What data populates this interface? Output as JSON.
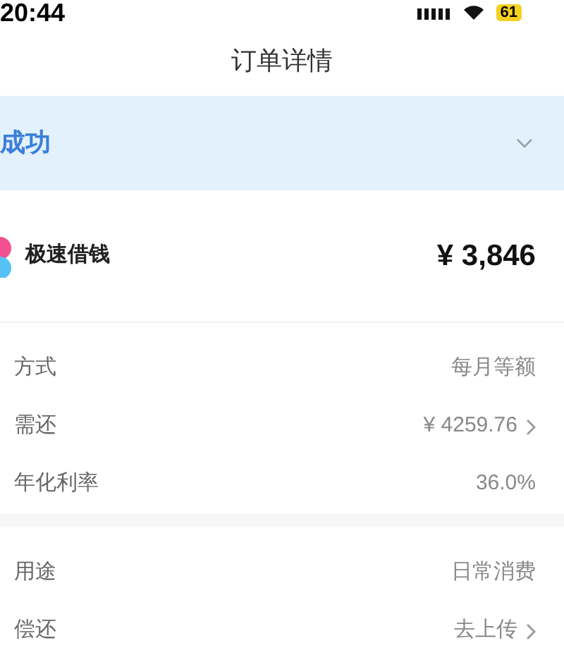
{
  "status_bar": {
    "time": "20:44",
    "battery": "61"
  },
  "header": {
    "title": "订单详情"
  },
  "status_banner": {
    "text": "成功",
    "expanded": false
  },
  "product": {
    "name": "极速借钱",
    "amount": "¥ 3,846"
  },
  "sections": [
    {
      "rows": [
        {
          "label": "方式",
          "value": "每月等额",
          "link": false
        },
        {
          "label": "需还",
          "value": "¥ 4259.76",
          "link": true
        },
        {
          "label": "年化利率",
          "value": "36.0%",
          "link": false
        }
      ]
    },
    {
      "rows": [
        {
          "label": "用途",
          "value": "日常消费",
          "link": false
        },
        {
          "label": "偿还",
          "value": "去上传",
          "link": true
        }
      ]
    }
  ]
}
